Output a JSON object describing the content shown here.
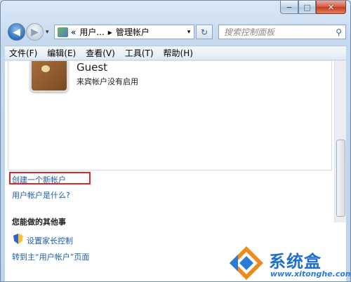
{
  "window": {
    "minimize_glyph": "−",
    "maximize_glyph": "□",
    "close_glyph": "✕"
  },
  "nav": {
    "back_glyph": "◀",
    "forward_glyph": "▶",
    "dropdown_glyph": "▾"
  },
  "address": {
    "prefix": "«",
    "crumb1": "用户...",
    "separator": "▸",
    "crumb2": "管理帐户",
    "dropdown_glyph": "▾",
    "refresh_glyph": "↻"
  },
  "search": {
    "placeholder": "搜索控制面板",
    "icon_glyph": "⚲"
  },
  "menu": {
    "items": [
      "文件(F)",
      "编辑(E)",
      "查看(V)",
      "工具(T)",
      "帮助(H)"
    ]
  },
  "account": {
    "name": "Guest",
    "status": "来宾帐户没有启用"
  },
  "links": {
    "create": "创建一个新帐户",
    "what_is": "用户帐户是什么?",
    "section_title": "您能做的其他事",
    "parental": "设置家长控制",
    "main_page": "转到主“用户帐户”页面"
  },
  "watermark": {
    "brand": "系统盒",
    "url": "www.xitonghe.com"
  },
  "colors": {
    "link": "#1b5dab",
    "highlight_border": "#e0262b",
    "watermark": "#1d6fd0"
  }
}
